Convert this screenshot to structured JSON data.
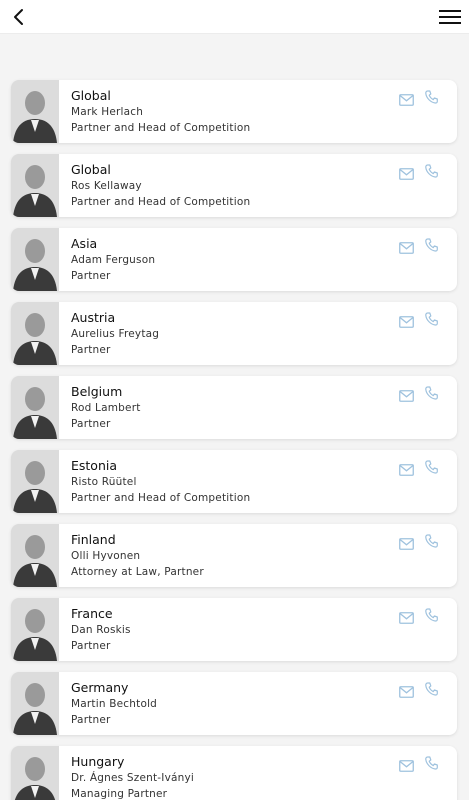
{
  "header": {
    "back_icon": "chevron-left-icon",
    "menu_icon": "hamburger-menu-icon"
  },
  "colors": {
    "contact_icon": "#9fc2de",
    "background": "#f4f4f4",
    "card": "#ffffff"
  },
  "contacts": [
    {
      "region": "Global",
      "name": "Mark Herlach",
      "title": "Partner and Head of Competition"
    },
    {
      "region": "Global",
      "name": "Ros Kellaway",
      "title": "Partner and Head of Competition"
    },
    {
      "region": "Asia",
      "name": "Adam Ferguson",
      "title": "Partner"
    },
    {
      "region": "Austria",
      "name": "Aurelius Freytag",
      "title": "Partner"
    },
    {
      "region": "Belgium",
      "name": "Rod Lambert",
      "title": "Partner"
    },
    {
      "region": "Estonia",
      "name": "Risto Rüütel",
      "title": "Partner and Head of Competition"
    },
    {
      "region": "Finland",
      "name": "Olli Hyvonen",
      "title": "Attorney at Law, Partner"
    },
    {
      "region": "France",
      "name": "Dan Roskis",
      "title": "Partner"
    },
    {
      "region": "Germany",
      "name": "Martin Bechtold",
      "title": "Partner"
    },
    {
      "region": "Hungary",
      "name": "Dr. Ágnes Szent-Iványi",
      "title": "Managing Partner"
    }
  ]
}
